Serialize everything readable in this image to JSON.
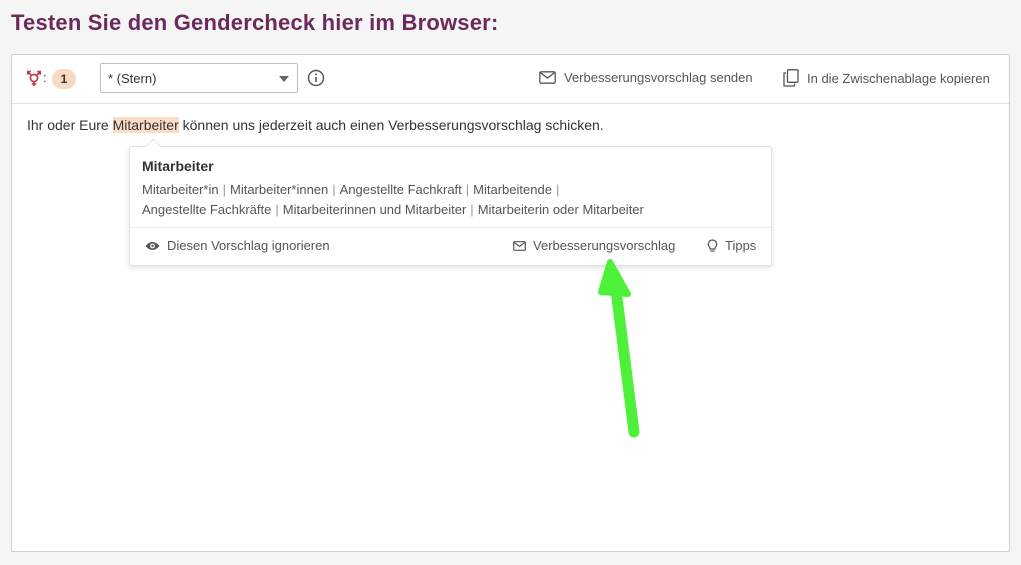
{
  "page": {
    "title": "Testen Sie den Gendercheck hier im Browser:"
  },
  "toolbar": {
    "gender_icon": "gender-symbol-icon",
    "colon": ":",
    "count": "1",
    "select_value": "* (Stern)",
    "info_icon": "info-icon",
    "send_label": "Verbesserungsvorschlag senden",
    "copy_label": "In die Zwischenablage kopieren"
  },
  "editor": {
    "before": "Ihr oder Eure ",
    "highlight": "Mitarbeiter",
    "after": " können uns jederzeit auch einen Verbesserungsvorschlag schicken."
  },
  "popup": {
    "word": "Mitarbeiter",
    "suggestions": [
      "Mitarbeiter*in",
      "Mitarbeiter*innen",
      "Angestellte Fachkraft",
      "Mitarbeitende",
      "Angestellte Fachkräfte",
      "Mitarbeiterinnen und Mitarbeiter",
      "Mitarbeiterin oder Mitarbeiter"
    ],
    "separator": "|",
    "ignore_label": "Diesen Vorschlag ignorieren",
    "suggest_label": "Verbesserungsvorschlag",
    "tips_label": "Tipps"
  },
  "colors": {
    "title": "#6b2a5b",
    "highlight": "#fbdcc6",
    "badge": "#f9d9c2",
    "gender_icon": "#c0354a",
    "arrow": "#4ef03a"
  }
}
